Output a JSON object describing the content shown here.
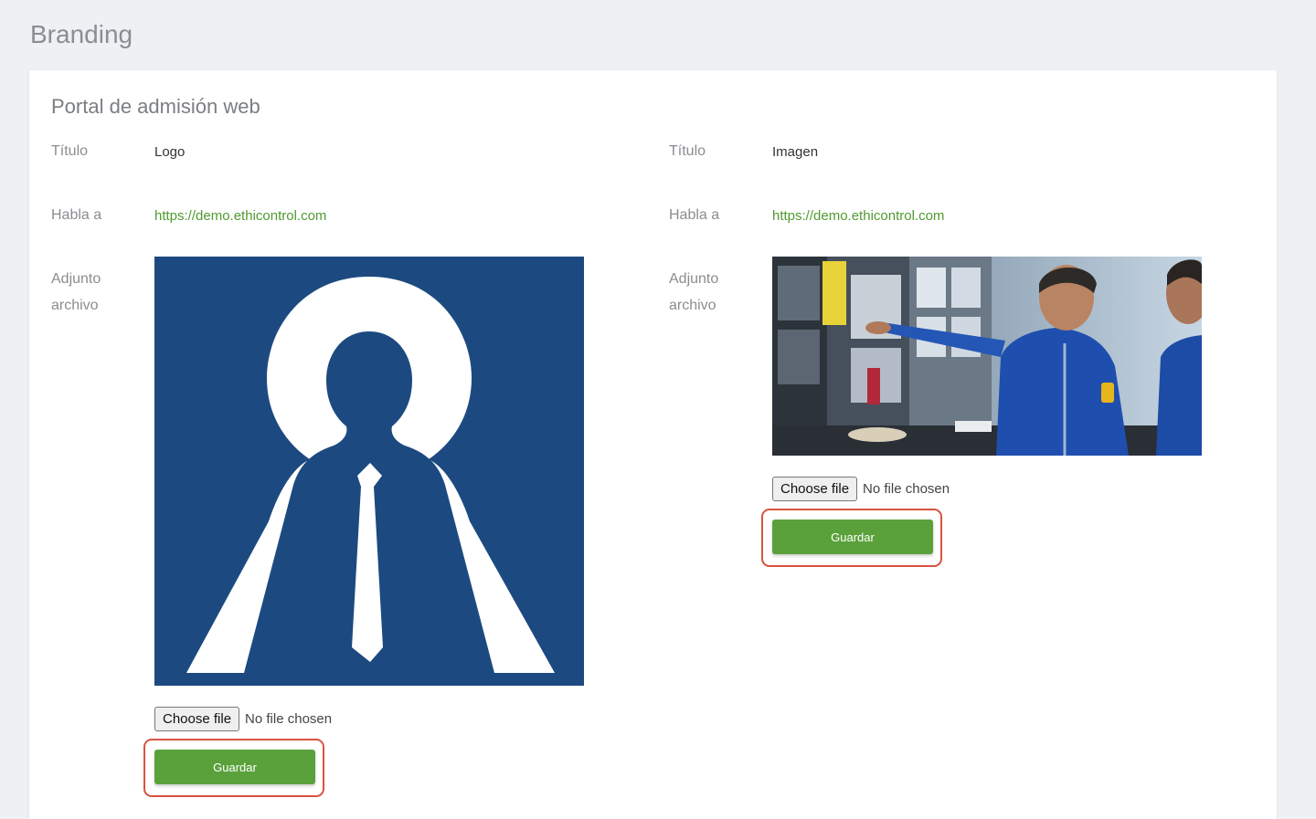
{
  "page": {
    "title": "Branding"
  },
  "section": {
    "title": "Portal de admisión web"
  },
  "left_panel": {
    "title_label": "Título",
    "title_value": "Logo",
    "speak_label": "Habla a",
    "speak_value": "https://demo.ethicontrol.com",
    "attach_label_1": "Adjunto",
    "attach_label_2": "archivo",
    "image_name": "logo-image",
    "file_button": "Choose file",
    "file_status": "No file chosen",
    "save_label": "Guardar"
  },
  "right_panel": {
    "title_label": "Título",
    "title_value": "Imagen",
    "speak_label": "Habla a",
    "speak_value": "https://demo.ethicontrol.com",
    "attach_label_1": "Adjunto",
    "attach_label_2": "archivo",
    "image_name": "banner-photo",
    "file_button": "Choose file",
    "file_status": "No file chosen",
    "save_label": "Guardar"
  },
  "colors": {
    "logo_blue": "#1c4a80",
    "link_green": "#4f9a2f",
    "button_green": "#5aa13b",
    "highlight_red": "#d9533f"
  }
}
